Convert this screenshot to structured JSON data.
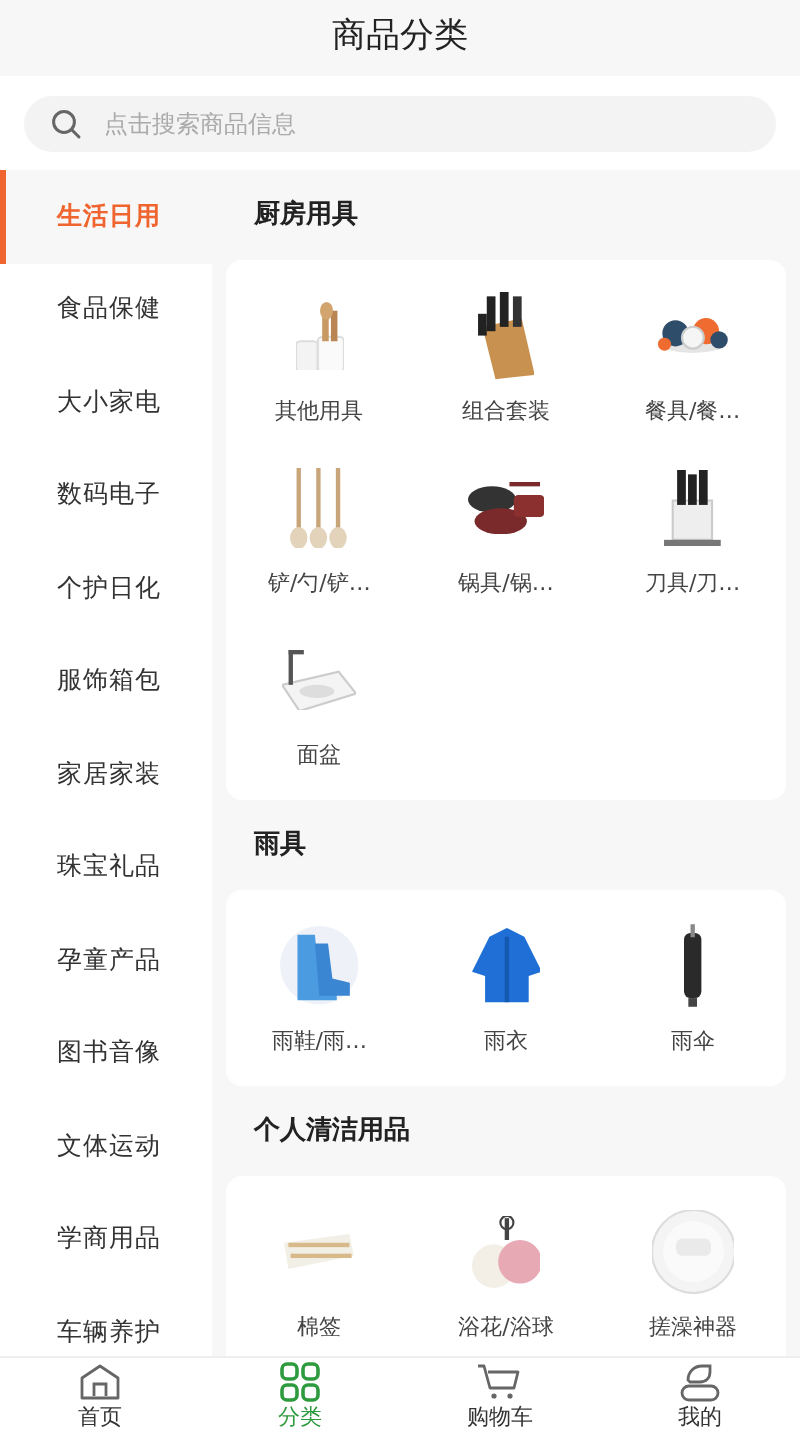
{
  "header": {
    "title": "商品分类"
  },
  "search": {
    "placeholder": "点击搜索商品信息"
  },
  "sidebar": {
    "items": [
      {
        "label": "生活日用",
        "selected": true
      },
      {
        "label": "食品保健",
        "selected": false
      },
      {
        "label": "大小家电",
        "selected": false
      },
      {
        "label": "数码电子",
        "selected": false
      },
      {
        "label": "个护日化",
        "selected": false
      },
      {
        "label": "服饰箱包",
        "selected": false
      },
      {
        "label": "家居家装",
        "selected": false
      },
      {
        "label": "珠宝礼品",
        "selected": false
      },
      {
        "label": "孕童产品",
        "selected": false
      },
      {
        "label": "图书音像",
        "selected": false
      },
      {
        "label": "文体运动",
        "selected": false
      },
      {
        "label": "学商用品",
        "selected": false
      },
      {
        "label": "车辆养护",
        "selected": false
      }
    ]
  },
  "sections": [
    {
      "title": "厨房用具",
      "items": [
        {
          "label": "其他用具"
        },
        {
          "label": "组合套装"
        },
        {
          "label": "餐具/餐…"
        },
        {
          "label": "铲/勺/铲…"
        },
        {
          "label": "锅具/锅…"
        },
        {
          "label": "刀具/刀…"
        },
        {
          "label": "面盆"
        }
      ]
    },
    {
      "title": "雨具",
      "items": [
        {
          "label": "雨鞋/雨…"
        },
        {
          "label": "雨衣"
        },
        {
          "label": "雨伞"
        }
      ]
    },
    {
      "title": "个人清洁用品",
      "items": [
        {
          "label": "棉签"
        },
        {
          "label": "浴花/浴球"
        },
        {
          "label": "搓澡神器"
        }
      ]
    }
  ],
  "tab_bar": {
    "tabs": [
      {
        "label": "首页",
        "kind": "home",
        "selected": false
      },
      {
        "label": "分类",
        "kind": "grid",
        "selected": true
      },
      {
        "label": "购物车",
        "kind": "cart",
        "selected": false
      },
      {
        "label": "我的",
        "kind": "user",
        "selected": false
      }
    ]
  }
}
